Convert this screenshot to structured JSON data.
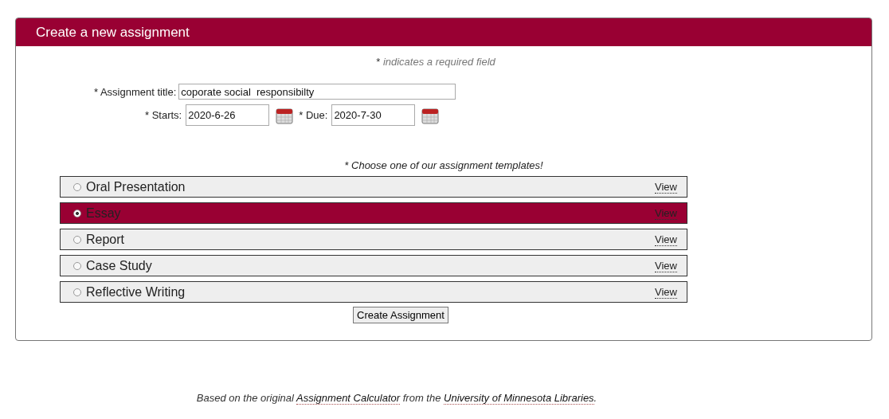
{
  "panel": {
    "title": "Create a new assignment"
  },
  "required_note": {
    "mark": "*",
    "text": "indicates a required field"
  },
  "fields": {
    "title": {
      "label": "* Assignment title:",
      "value": "coporate social  responsibilty"
    },
    "starts": {
      "label": "* Starts:",
      "value": "2020-6-26"
    },
    "due": {
      "label": "* Due:",
      "value": "2020-7-30"
    }
  },
  "templates_prompt": "* Choose one of our assignment templates!",
  "templates": [
    {
      "label": "Oral Presentation",
      "selected": false,
      "link": "View"
    },
    {
      "label": "Essay",
      "selected": true,
      "link": "View"
    },
    {
      "label": "Report",
      "selected": false,
      "link": "View"
    },
    {
      "label": "Case Study",
      "selected": false,
      "link": "View"
    },
    {
      "label": "Reflective Writing",
      "selected": false,
      "link": "View"
    }
  ],
  "submit": "Create Assignment",
  "footer": {
    "parts": [
      {
        "kind": "text",
        "text": "Based on the original "
      },
      {
        "kind": "link",
        "text": "Assignment Calculator"
      },
      {
        "kind": "text",
        "text": " from the "
      },
      {
        "kind": "link",
        "text": "University of Minnesota Libraries"
      },
      {
        "kind": "text",
        "text": "."
      }
    ]
  }
}
